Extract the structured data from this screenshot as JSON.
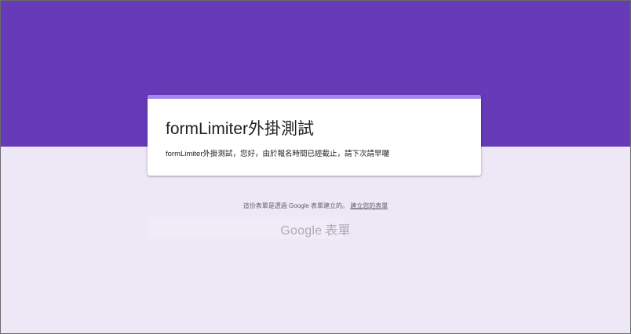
{
  "colors": {
    "header_band": "#673ab7",
    "background": "#ede7f6",
    "card_accent": "#a487f0"
  },
  "form": {
    "title": "formLimiter外掛測試",
    "message": "formLimiter外掛測試，您好，由於報名時間已經截止，請下次請早囉"
  },
  "footer": {
    "note": "這份表單是透過 Google 表單建立的。",
    "link_label": "建立您的表單"
  },
  "brand": {
    "google": "Google",
    "product": "表單"
  }
}
